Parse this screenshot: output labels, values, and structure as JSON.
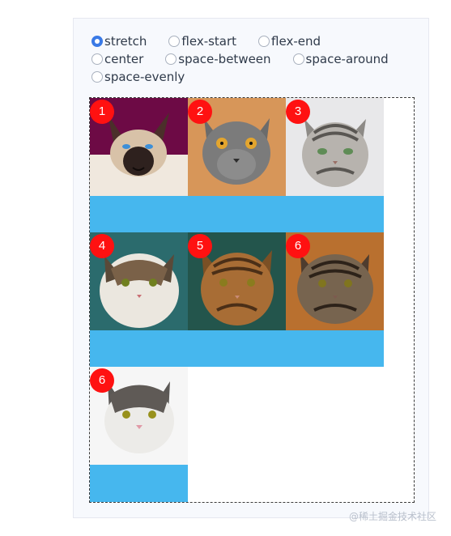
{
  "radios": {
    "options": [
      {
        "label": "stretch",
        "checked": true
      },
      {
        "label": "flex-start",
        "checked": false
      },
      {
        "label": "flex-end",
        "checked": false
      },
      {
        "label": "center",
        "checked": false
      },
      {
        "label": "space-between",
        "checked": false
      },
      {
        "label": "space-around",
        "checked": false
      },
      {
        "label": "space-evenly",
        "checked": false
      }
    ]
  },
  "gallery": {
    "items": [
      {
        "badge": "1",
        "icon": "siamese-cat-photo"
      },
      {
        "badge": "2",
        "icon": "british-shorthair-cat-photo"
      },
      {
        "badge": "3",
        "icon": "silver-tabby-cat-photo"
      },
      {
        "badge": "4",
        "icon": "longhair-tabby-cat-photo"
      },
      {
        "badge": "5",
        "icon": "maine-coon-cat-photo"
      },
      {
        "badge": "6",
        "icon": "brown-tabby-cat-photo"
      },
      {
        "badge": "6",
        "icon": "white-tabby-cat-photo"
      }
    ]
  },
  "colors": {
    "accent": "#3b7ae6",
    "badge": "#ff1111",
    "strip": "#46b7ee"
  },
  "watermark": "@稀土掘金技术社区"
}
